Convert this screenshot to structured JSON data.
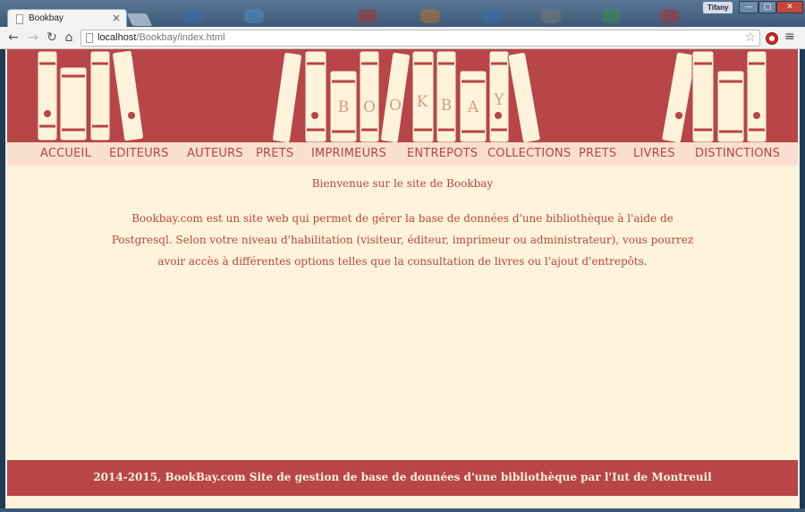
{
  "browser": {
    "tab_title": "Bookbay",
    "tab_close": "×",
    "user_badge": "Tifany",
    "url_host": "localhost",
    "url_path": "/Bookbay/index.html",
    "controls": {
      "minimize": "—",
      "maximize": "□",
      "close": "✕"
    },
    "star": "☆",
    "menu": "≡"
  },
  "site": {
    "logo_text": "BOOKBAY",
    "nav": [
      "ACCUEIL",
      "EDITEURS",
      "AUTEURS",
      "PRETS",
      "IMPRIMEURS",
      "ENTREPOTS",
      "COLLECTIONS",
      "PRETS",
      "LIVRES",
      "DISTINCTIONS"
    ],
    "welcome": "Bienvenue sur le site de Bookbay",
    "intro": "Bookbay.com est un site web qui permet de gérer la base de données d'une bibliothèque à l'aide de Postgresql. Selon votre niveau d'habilitation (visiteur, éditeur, imprimeur ou administrateur), vous pourrez avoir accès à différentes options telles que la consultation de livres ou l'ajout d'entrepôts.",
    "footer": "2014-2015, BookBay.com Site de gestion de base de données d'une bibliothèque par l'Iut de Montreuil"
  },
  "colors": {
    "brand_red": "#b84547",
    "cream": "#fcf3da",
    "nav_bg": "#f9dfd0"
  }
}
